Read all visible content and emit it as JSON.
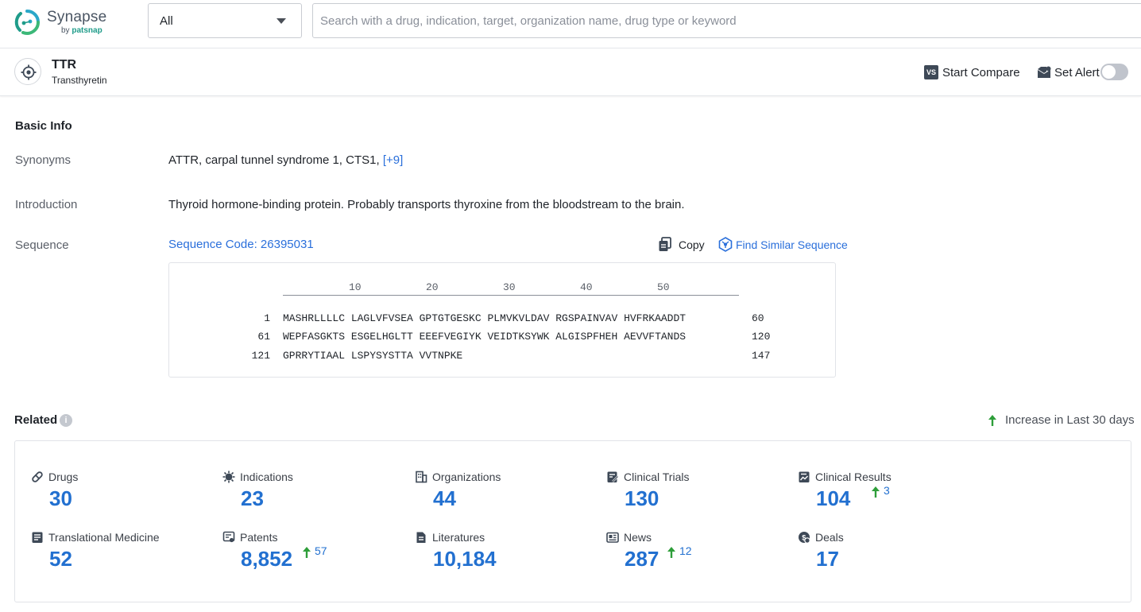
{
  "brand": {
    "name": "Synapse",
    "by": "by",
    "company": "patsnap",
    "color": "#1f9c8a"
  },
  "search": {
    "scope": "All",
    "placeholder": "Search with a drug, indication, target, organization name, drug type or keyword",
    "value": ""
  },
  "target": {
    "symbol": "TTR",
    "full_name": "Transthyretin",
    "icon": "target-icon"
  },
  "actions": {
    "compare_badge": "VS",
    "compare_label": "Start Compare",
    "alert_label": "Set Alert",
    "alert_enabled": false
  },
  "basic_info": {
    "title": "Basic Info",
    "synonyms_label": "Synonyms",
    "synonyms": "ATTR,  carpal tunnel syndrome 1,  CTS1,",
    "synonyms_more": "[+9]",
    "introduction_label": "Introduction",
    "introduction": "Thyroid hormone-binding protein. Probably transports thyroxine from the bloodstream to the brain.",
    "sequence_label": "Sequence",
    "sequence_code": "Sequence Code: 26395031",
    "copy_label": "Copy",
    "find_similar_label": "Find Similar Sequence"
  },
  "sequence": {
    "ruler": [
      "10",
      "20",
      "30",
      "40",
      "50"
    ],
    "rows": [
      {
        "start": "1",
        "residues": "MASHRLLLLC LAGLVFVSEA GPTGTGESKC PLMVKVLDAV RGSPAINVAV HVFRKAADDT",
        "end": "60"
      },
      {
        "start": "61",
        "residues": "WEPFASGKTS ESGELHGLTT EEEFVEGIYK VEIDTKSYWK ALGISPFHEH AEVVFTANDS",
        "end": "120"
      },
      {
        "start": "121",
        "residues": "GPRRYTIAAL LSPYSYSTTA VVTNPKE",
        "end": "147"
      }
    ]
  },
  "related": {
    "title": "Related",
    "info": "i",
    "legend": "Increase in Last 30 days",
    "accent": "#2270d0",
    "increase_color": "#2e9e3a",
    "items": [
      {
        "name": "Drugs",
        "value": "30",
        "icon": "pill-icon"
      },
      {
        "name": "Indications",
        "value": "23",
        "icon": "virus-icon"
      },
      {
        "name": "Organizations",
        "value": "44",
        "icon": "building-icon"
      },
      {
        "name": "Clinical Trials",
        "value": "130",
        "icon": "clipboard-icon"
      },
      {
        "name": "Clinical Results",
        "value": "104",
        "icon": "chart-doc-icon",
        "increase": "3"
      },
      {
        "name": "Translational Medicine",
        "value": "52",
        "icon": "book-icon"
      },
      {
        "name": "Patents",
        "value": "8,852",
        "icon": "patent-icon",
        "increase": "57"
      },
      {
        "name": "Literatures",
        "value": "10,184",
        "icon": "document-icon"
      },
      {
        "name": "News",
        "value": "287",
        "icon": "news-icon",
        "increase": "12"
      },
      {
        "name": "Deals",
        "value": "17",
        "icon": "handshake-icon"
      }
    ]
  }
}
